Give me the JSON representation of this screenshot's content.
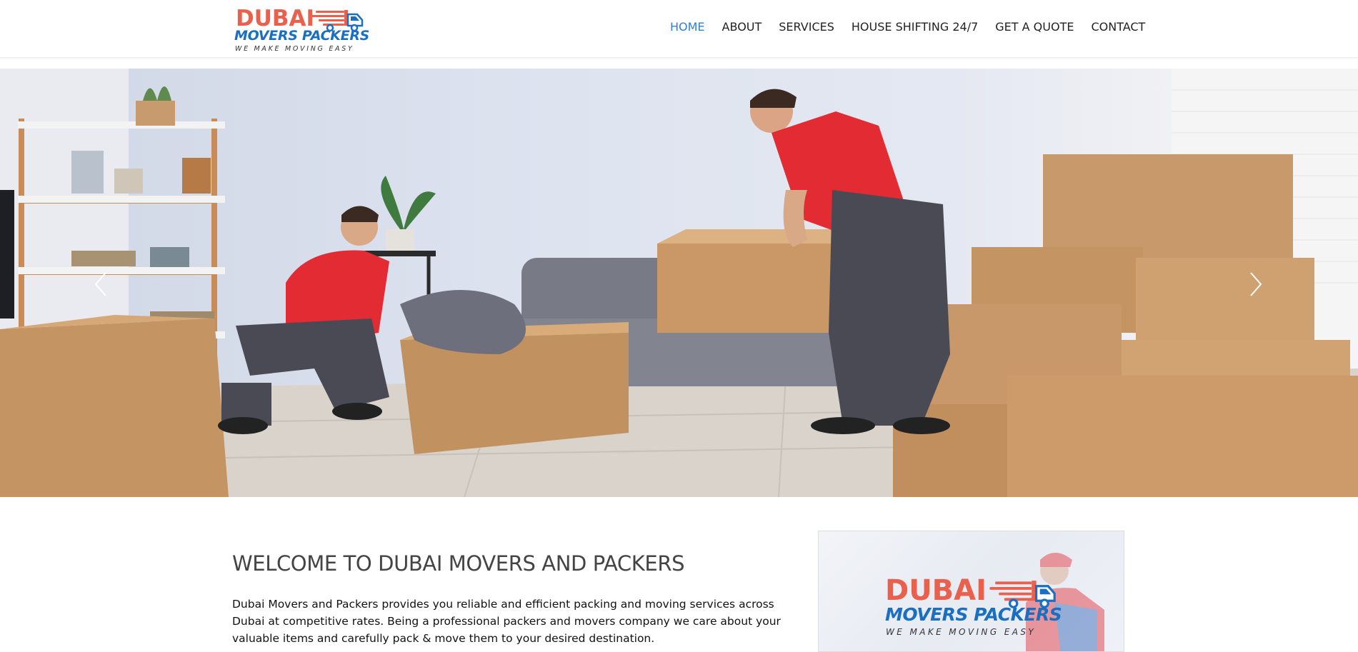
{
  "brand": {
    "word1": "DUBAI",
    "word2": "MOVERS PACKERS",
    "tagline": "WE MAKE MOVING EASY"
  },
  "nav": {
    "items": [
      {
        "label": "HOME",
        "active": true
      },
      {
        "label": "ABOUT"
      },
      {
        "label": "SERVICES"
      },
      {
        "label": "HOUSE SHIFTING 24/7"
      },
      {
        "label": "GET A QUOTE"
      },
      {
        "label": "CONTACT"
      }
    ]
  },
  "hero": {
    "prev_icon": "chevron-left-icon",
    "next_icon": "chevron-right-icon"
  },
  "welcome": {
    "title": "WELCOME TO DUBAI MOVERS AND PACKERS",
    "text": "Dubai Movers and Packers provides you reliable and efficient packing and moving services across Dubai at competitive rates. Being a professional packers and movers company we care about your valuable items and carefully pack & move them to your desired destination."
  },
  "colors": {
    "accent": "#2f7fd4",
    "brand_red": "#e9604c",
    "brand_blue": "#1b6fc3"
  }
}
